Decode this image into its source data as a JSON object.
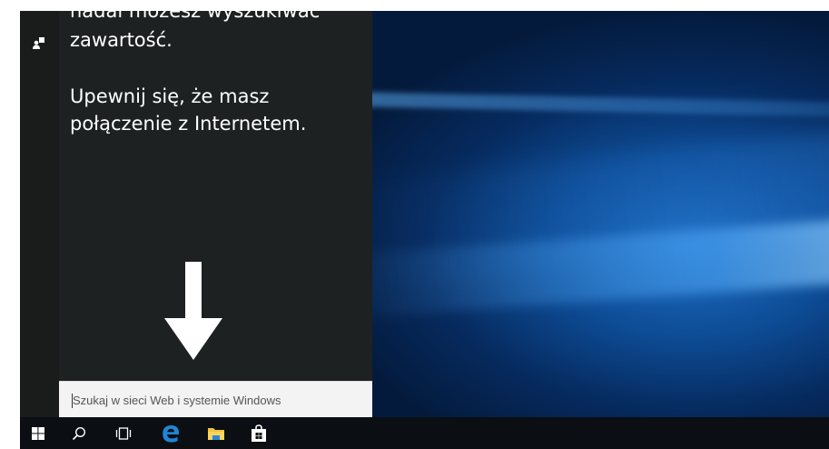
{
  "cortana": {
    "message_line1": "nadal możesz wyszukiwać",
    "message_line2": "zawartość.",
    "message_line3": "Upewnij się, że masz",
    "message_line4": "połączenie z Internetem."
  },
  "search": {
    "placeholder": "Szukaj w sieci Web i systemie Windows"
  },
  "taskbar": {
    "icons": [
      "windows-start-icon",
      "search-icon",
      "task-view-icon",
      "edge-icon",
      "file-explorer-icon",
      "store-icon"
    ]
  },
  "colors": {
    "panel_bg": "#1e2122",
    "taskbar_bg": "#0b0e12",
    "edge_blue": "#1e86d6",
    "explorer_yellow": "#f4c33a"
  }
}
